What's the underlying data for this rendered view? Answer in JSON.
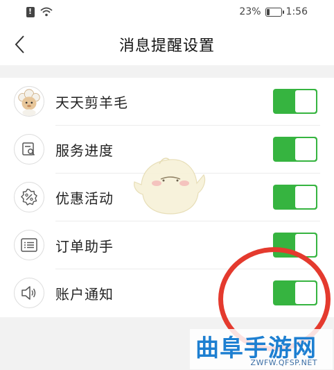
{
  "status_bar": {
    "battery_text": "23%",
    "time": "1:56",
    "battery_level": 0.23
  },
  "nav": {
    "title": "消息提醒设置"
  },
  "settings": [
    {
      "label": "天天剪羊毛",
      "icon": "sheep-avatar-icon",
      "enabled": true
    },
    {
      "label": "服务进度",
      "icon": "document-search-icon",
      "enabled": true
    },
    {
      "label": "优惠活动",
      "icon": "discount-badge-icon",
      "enabled": true
    },
    {
      "label": "订单助手",
      "icon": "list-card-icon",
      "enabled": true
    },
    {
      "label": "账户通知",
      "icon": "speaker-icon",
      "enabled": true
    }
  ],
  "watermark": {
    "title": "曲阜手游网",
    "url": "ZWFW.QFSP.NET"
  },
  "colors": {
    "toggle_on": "#36b440",
    "highlight_circle": "#e43a2e",
    "watermark": "#1d7fd1"
  }
}
